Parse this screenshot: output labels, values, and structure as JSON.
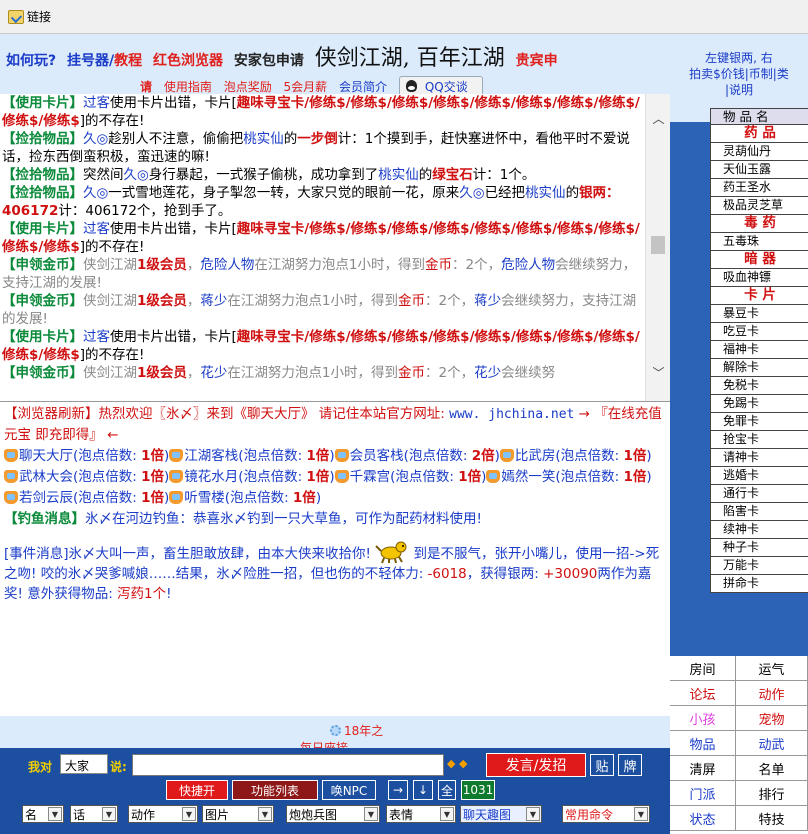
{
  "topbar": {
    "link_label": "链接"
  },
  "header": {
    "row1": [
      {
        "text": "如何玩?",
        "color": "blue"
      },
      {
        "text": "挂号器/",
        "color": "blue"
      },
      {
        "text": "教程",
        "color": "red"
      },
      {
        "text": "红色浏览器",
        "color": "red"
      },
      {
        "text": "安家包申请",
        "color": "dark"
      },
      {
        "text": "贵宾申",
        "color": "red"
      }
    ],
    "big_title": "侠剑江湖, 百年江湖",
    "row2": [
      {
        "text": "请",
        "color": "red"
      },
      {
        "text": "使用指南",
        "color": "red"
      },
      {
        "text": "泡点奖励",
        "color": "red"
      },
      {
        "text": "5会月薪",
        "color": "red"
      },
      {
        "text": "会员简介",
        "color": "blue"
      }
    ],
    "qq_label": "QQ交谈"
  },
  "log1": {
    "messages": [
      [
        {
          "t": "【使用卡片】",
          "c": "g"
        },
        {
          "t": "过客",
          "c": "bl"
        },
        {
          "t": "使用卡片出错，卡片[",
          "c": "bk"
        },
        {
          "t": "趣味寻宝卡/修练$/修练$/修练$/修练$/修练$/修练$/修练$/修练$/修练$/修练$",
          "c": "rdb"
        },
        {
          "t": "]的不存在!",
          "c": "bk"
        }
      ],
      [
        {
          "t": "【捡拾物品】",
          "c": "g"
        },
        {
          "t": "久◎",
          "c": "bl"
        },
        {
          "t": "趁别人不注意，偷偷把",
          "c": "bk"
        },
        {
          "t": "桃实仙",
          "c": "bl"
        },
        {
          "t": "的",
          "c": "bk"
        },
        {
          "t": "一步倒",
          "c": "rdb"
        },
        {
          "t": "计：1个摸到手，赶快塞进怀中，看他平时不爱说话，捡东西倒蛮积极，蛮迅速的嘛!",
          "c": "bk"
        }
      ],
      [
        {
          "t": "【捡拾物品】",
          "c": "g"
        },
        {
          "t": "突然间",
          "c": "bk"
        },
        {
          "t": "久◎",
          "c": "bl"
        },
        {
          "t": "身行暴起，一式猴子偷桃，成功拿到了",
          "c": "bk"
        },
        {
          "t": "桃实仙",
          "c": "bl"
        },
        {
          "t": "的",
          "c": "bk"
        },
        {
          "t": "绿宝石",
          "c": "rdb"
        },
        {
          "t": "计：1个。",
          "c": "bk"
        }
      ],
      [
        {
          "t": "【捡拾物品】",
          "c": "g"
        },
        {
          "t": "久◎",
          "c": "bl"
        },
        {
          "t": "一式雪地莲花，身子掣忽一转，大家只觉的眼前一花，原来",
          "c": "bk"
        },
        {
          "t": "久◎",
          "c": "bl"
        },
        {
          "t": "已经把",
          "c": "bk"
        },
        {
          "t": "桃实仙",
          "c": "bl"
        },
        {
          "t": "的",
          "c": "bk"
        },
        {
          "t": "银两：406172",
          "c": "rdb"
        },
        {
          "t": "计：406172个，抢到手了。",
          "c": "bk"
        }
      ],
      [
        {
          "t": "【使用卡片】",
          "c": "g"
        },
        {
          "t": "过客",
          "c": "bl"
        },
        {
          "t": "使用卡片出错，卡片[",
          "c": "bk"
        },
        {
          "t": "趣味寻宝卡/修练$/修练$/修练$/修练$/修练$/修练$/修练$/修练$/修练$/修练$",
          "c": "rdb"
        },
        {
          "t": "]的不存在!",
          "c": "bk"
        }
      ],
      [
        {
          "t": "【申领金币】",
          "c": "g"
        },
        {
          "t": "侠剑江湖",
          "c": "gr"
        },
        {
          "t": "1级会员",
          "c": "rdb"
        },
        {
          "t": "，",
          "c": "gr"
        },
        {
          "t": "危险人物",
          "c": "bl"
        },
        {
          "t": "在江湖努力泡点1小时，得到",
          "c": "gr"
        },
        {
          "t": "金币",
          "c": "rd"
        },
        {
          "t": "：2个，",
          "c": "gr"
        },
        {
          "t": "危险人物",
          "c": "bl"
        },
        {
          "t": "会继续努力，支持江湖的发展!",
          "c": "gr"
        }
      ],
      [
        {
          "t": "【申领金币】",
          "c": "g"
        },
        {
          "t": "侠剑江湖",
          "c": "gr"
        },
        {
          "t": "1级会员",
          "c": "rdb"
        },
        {
          "t": "，",
          "c": "gr"
        },
        {
          "t": "蒋少",
          "c": "bl"
        },
        {
          "t": "在江湖努力泡点1小时，得到",
          "c": "gr"
        },
        {
          "t": "金币",
          "c": "rd"
        },
        {
          "t": "：2个，",
          "c": "gr"
        },
        {
          "t": "蒋少",
          "c": "bl"
        },
        {
          "t": "会继续努力，支持江湖的发展!",
          "c": "gr"
        }
      ],
      [
        {
          "t": "【使用卡片】",
          "c": "g"
        },
        {
          "t": "过客",
          "c": "bl"
        },
        {
          "t": "使用卡片出错，卡片[",
          "c": "bk"
        },
        {
          "t": "趣味寻宝卡/修练$/修练$/修练$/修练$/修练$/修练$/修练$/修练$/修练$/修练$",
          "c": "rdb"
        },
        {
          "t": "]的不存在!",
          "c": "bk"
        }
      ],
      [
        {
          "t": "【申领金币】",
          "c": "g"
        },
        {
          "t": "侠剑江湖",
          "c": "gr"
        },
        {
          "t": "1级会员",
          "c": "rdb"
        },
        {
          "t": "，",
          "c": "gr"
        },
        {
          "t": "花少",
          "c": "bl"
        },
        {
          "t": "在江湖努力泡点1小时，得到",
          "c": "gr"
        },
        {
          "t": "金币",
          "c": "rd"
        },
        {
          "t": "：2个，",
          "c": "gr"
        },
        {
          "t": "花少",
          "c": "bl"
        },
        {
          "t": "会继续努",
          "c": "gr"
        }
      ]
    ]
  },
  "log2": {
    "welcome_prefix": "【浏览器刷新】热烈欢迎〖氷〆〗来到《聊天大厅》 请记住本站官方网址: ",
    "welcome_url": "www. jhchina.net",
    "welcome_suffix": " → 『在线充值元宝 即充即得』 ←",
    "rooms": [
      {
        "name": "聊天大厅",
        "mult": "1倍"
      },
      {
        "name": "江湖客栈",
        "mult": "1倍"
      },
      {
        "name": "会员客栈",
        "mult": "2倍"
      },
      {
        "name": "比武房",
        "mult": "1倍"
      },
      {
        "name": "武林大会",
        "mult": "1倍"
      },
      {
        "name": "镜花水月",
        "mult": "1倍"
      },
      {
        "name": "千霖宫",
        "mult": "1倍"
      },
      {
        "name": "嫣然一笑",
        "mult": "1倍"
      },
      {
        "name": "若剑云辰",
        "mult": "1倍"
      },
      {
        "name": "听雪楼",
        "mult": "1倍"
      }
    ],
    "mult_prefix": "(泡点倍数: ",
    "mult_suffix": ")",
    "fishing_tag": "【钓鱼消息】",
    "fishing_text": "氷〆在河边钓鱼：恭喜氷〆钓到一只大草鱼，可作为配药材料使用!",
    "event_part1": "[事件消息]氷〆大叫一声，畜生胆敢放肆，由本大侠来收拾你!",
    "event_part2": "到是不服气，张开小嘴儿，使用一招->死之吻! 咬的氷〆哭爹喊娘……结果，氷〆险胜一招，但也伤的不轻体力: ",
    "event_hp": "-6018",
    "event_mid": "，获得银两: ",
    "event_silver": "+30090",
    "event_mid2": "两作为嘉奖! 意外获得物品: ",
    "event_item": "泻药1个",
    "event_end": "!"
  },
  "notice": {
    "text": "18年之",
    "text2": "每日座接"
  },
  "bottom": {
    "me_label": "我对",
    "target_value": "大家",
    "say_label": "说:",
    "chat_input_value": "",
    "send_label": "发言/发招",
    "tie_label": "贴",
    "pai_label": "牌",
    "row2": [
      {
        "label": "快捷开",
        "style": "red"
      },
      {
        "label": "功能列表",
        "style": "dark"
      },
      {
        "label": "唤NPC",
        "style": "blue"
      },
      {
        "label": "→",
        "style": "blue"
      },
      {
        "label": "↓",
        "style": "blue"
      },
      {
        "label": "全",
        "style": "blue"
      },
      {
        "label": "1031",
        "style": "green"
      }
    ],
    "selects": [
      {
        "label": "名"
      },
      {
        "label": "话"
      },
      {
        "label": "动作"
      },
      {
        "label": "图片"
      },
      {
        "label": "炮炮兵图"
      },
      {
        "label": "表情"
      },
      {
        "label": "聊天趣图"
      },
      {
        "label": "常用命令"
      }
    ]
  },
  "side": {
    "top_line1": "左键银两, 右",
    "top_line2": "拍卖$价钱|币制|类",
    "top_line3": "|说明",
    "header": "物 品 名",
    "sections": [
      {
        "title": "药 品",
        "items": [
          "灵葫仙丹",
          "天仙玉露",
          "药王圣水",
          "极品灵芝草"
        ]
      },
      {
        "title": "毒 药",
        "items": [
          "五毒珠"
        ]
      },
      {
        "title": "暗 器",
        "items": [
          "吸血神镖"
        ]
      },
      {
        "title": "卡 片",
        "items": [
          "暴豆卡",
          "吃豆卡",
          "福神卡",
          "解除卡",
          "免税卡",
          "免踢卡",
          "免罪卡",
          "抢宝卡",
          "请神卡",
          "逃婚卡",
          "通行卡",
          "陷害卡",
          "续神卡",
          "种子卡",
          "万能卡",
          "拼命卡"
        ]
      }
    ],
    "menu": [
      {
        "label": "房间",
        "c": "blk"
      },
      {
        "label": "运气",
        "c": "blk"
      },
      {
        "label": "论坛",
        "c": "red"
      },
      {
        "label": "动作",
        "c": "red"
      },
      {
        "label": "小孩",
        "c": "pink"
      },
      {
        "label": "宠物",
        "c": "red"
      },
      {
        "label": "物品",
        "c": "blue"
      },
      {
        "label": "动武",
        "c": "blue"
      },
      {
        "label": "清屏",
        "c": "blk"
      },
      {
        "label": "名单",
        "c": "blk"
      },
      {
        "label": "门派",
        "c": "blue"
      },
      {
        "label": "排行",
        "c": "blk"
      },
      {
        "label": "状态",
        "c": "blue"
      },
      {
        "label": "特技",
        "c": "blk"
      }
    ]
  },
  "colors": {
    "header_bg": "#dcebfb",
    "bottom_bg": "#1c4fa0",
    "side_bg": "#2c63b6",
    "accent_red": "#e01a1a"
  }
}
